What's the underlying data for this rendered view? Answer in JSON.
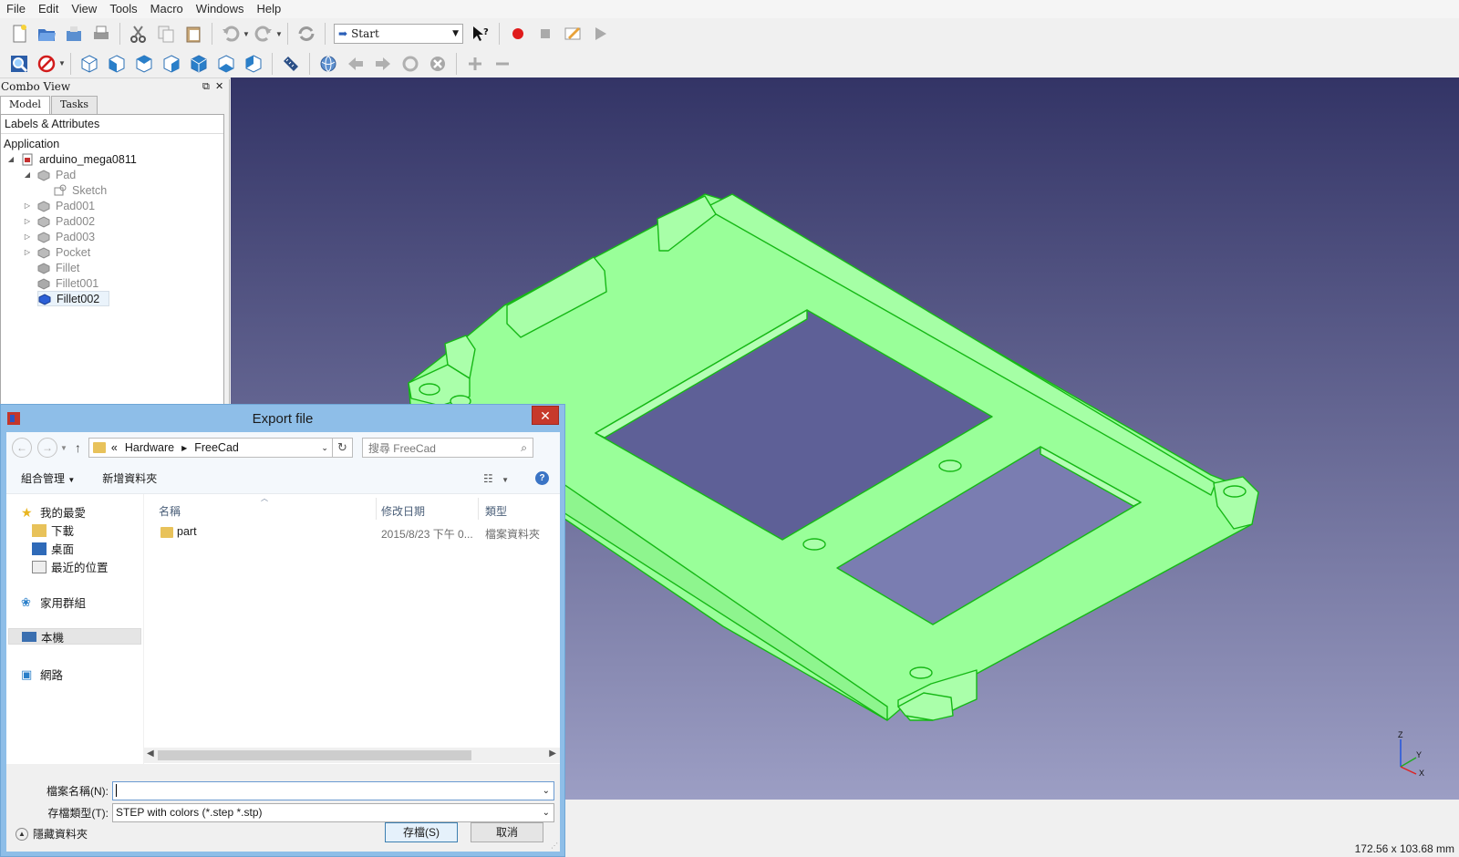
{
  "menu": [
    "File",
    "Edit",
    "View",
    "Tools",
    "Macro",
    "Windows",
    "Help"
  ],
  "toolbar": {
    "workbench": "Start"
  },
  "combo_view": {
    "title": "Combo View",
    "tabs": [
      "Model",
      "Tasks"
    ],
    "tree_header": "Labels & Attributes",
    "root_label": "Application",
    "document": "arduino_mega0811",
    "items": {
      "pad": "Pad",
      "sketch": "Sketch",
      "pad001": "Pad001",
      "pad002": "Pad002",
      "pad003": "Pad003",
      "pocket": "Pocket",
      "fillet": "Fillet",
      "fillet001": "Fillet001",
      "fillet002": "Fillet002"
    }
  },
  "view3d": {
    "model_color": "#99ff99",
    "edge_color": "#15b815",
    "dimensions": "172.56 x 103.68 mm",
    "axes": {
      "x": "X",
      "y": "Y",
      "z": "Z"
    }
  },
  "dialog": {
    "title": "Export file",
    "breadcrumb": {
      "prefix": "«",
      "parent": "Hardware",
      "current": "FreeCad"
    },
    "search_placeholder": "搜尋 FreeCad",
    "commands": {
      "organize": "組合管理",
      "new_folder": "新增資料夾"
    },
    "nav": {
      "favorites": "我的最愛",
      "downloads": "下載",
      "desktop": "桌面",
      "recent": "最近的位置",
      "homegroup": "家用群組",
      "this_pc": "本機",
      "network": "網路"
    },
    "columns": {
      "name": "名稱",
      "modified": "修改日期",
      "type": "類型"
    },
    "files": [
      {
        "name": "part",
        "modified": "2015/8/23 下午 0...",
        "type": "檔案資料夾"
      }
    ],
    "filename_label": "檔案名稱(N):",
    "filename_value": "",
    "filetype_label": "存檔類型(T):",
    "filetype_value": "STEP with colors (*.step *.stp)",
    "hide_folders": "隱藏資料夾",
    "save_button": "存檔(S)",
    "cancel_button": "取消"
  }
}
